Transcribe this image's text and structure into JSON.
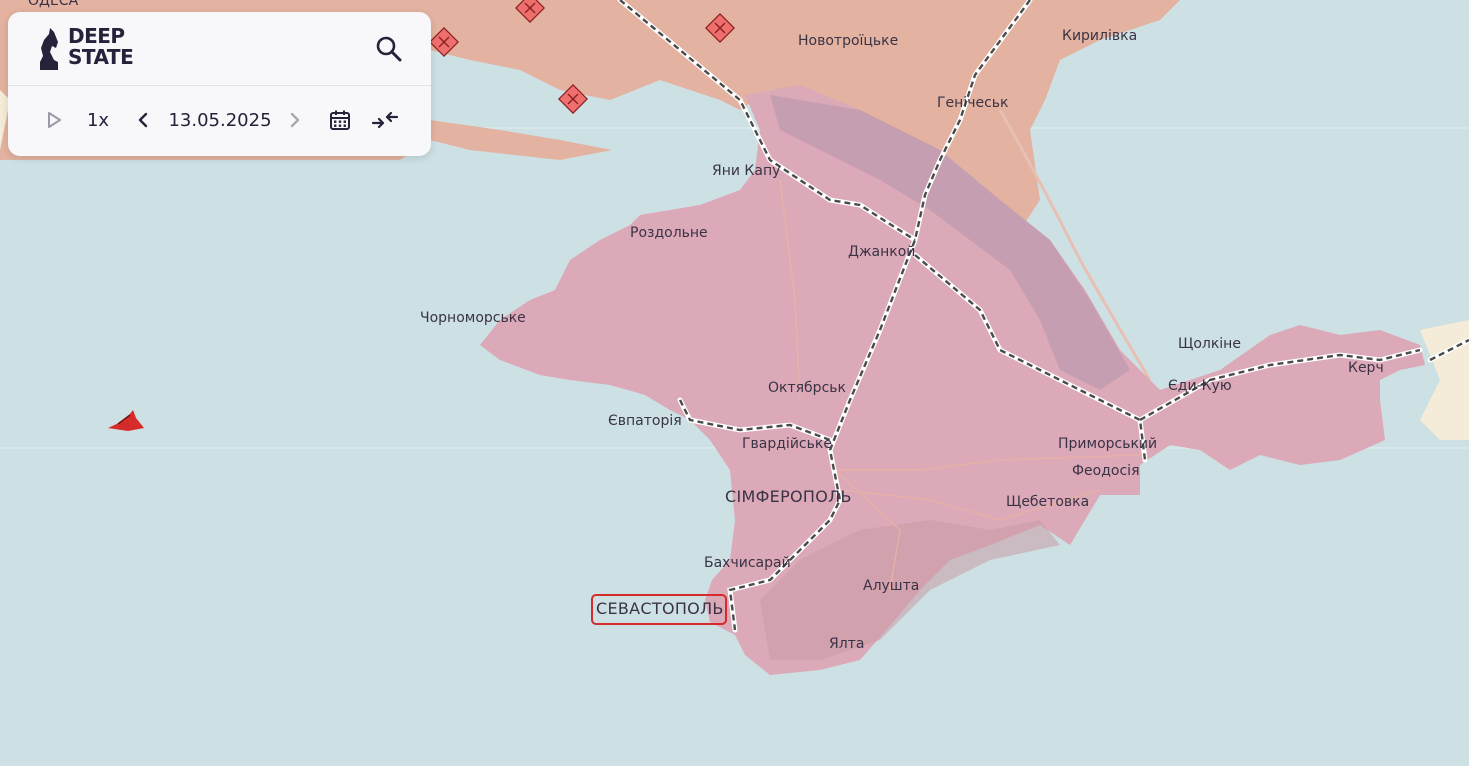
{
  "app": {
    "logo_line1": "DEEP",
    "logo_line2": "STATE"
  },
  "toolbar": {
    "speed_label": "1x",
    "date_value": "13.05.2025"
  },
  "icons": {
    "search": "search-icon",
    "play": "play-icon",
    "prev": "chevron-left-icon",
    "next": "chevron-right-icon",
    "calendar": "calendar-icon",
    "collapse": "collapse-arrows-icon"
  },
  "colors": {
    "sea": "#cde0e3",
    "occupied_crimea": "#dba9b7",
    "occupied_mainland": "#e3b2a0",
    "highlight": "#d62b2b"
  },
  "map": {
    "cities": [
      {
        "id": "odesa",
        "label": "ОДЕСА"
      },
      {
        "id": "novotroitske",
        "label": "Новотроїцьке"
      },
      {
        "id": "kyrylivka",
        "label": "Кирилівка"
      },
      {
        "id": "henichesk",
        "label": "Генічеськ"
      },
      {
        "id": "yany-kapu",
        "label": "Яни Капу"
      },
      {
        "id": "rozdolne",
        "label": "Роздольне"
      },
      {
        "id": "dzhankoi",
        "label": "Джанкой"
      },
      {
        "id": "chornomorske",
        "label": "Чорноморське"
      },
      {
        "id": "shcholkine",
        "label": "Щолкіне"
      },
      {
        "id": "kerch",
        "label": "Керч"
      },
      {
        "id": "oktiabrske",
        "label": "Октябрськ"
      },
      {
        "id": "edi-kuiu",
        "label": "Єди-Кую"
      },
      {
        "id": "yevpatoriia",
        "label": "Євпаторія"
      },
      {
        "id": "hvardiiske",
        "label": "Гвардійське"
      },
      {
        "id": "prymorskyi",
        "label": "Приморський"
      },
      {
        "id": "feodosiia",
        "label": "Феодосія"
      },
      {
        "id": "simferopol",
        "label": "СІМФЕРОПОЛЬ"
      },
      {
        "id": "shchebetovka",
        "label": "Щебетовка"
      },
      {
        "id": "bakhchysarai",
        "label": "Бахчисарай"
      },
      {
        "id": "alushta",
        "label": "Алушта"
      },
      {
        "id": "sevastopol",
        "label": "СЕВАСТОПОЛЬ"
      },
      {
        "id": "yalta",
        "label": "Ялта"
      }
    ]
  }
}
